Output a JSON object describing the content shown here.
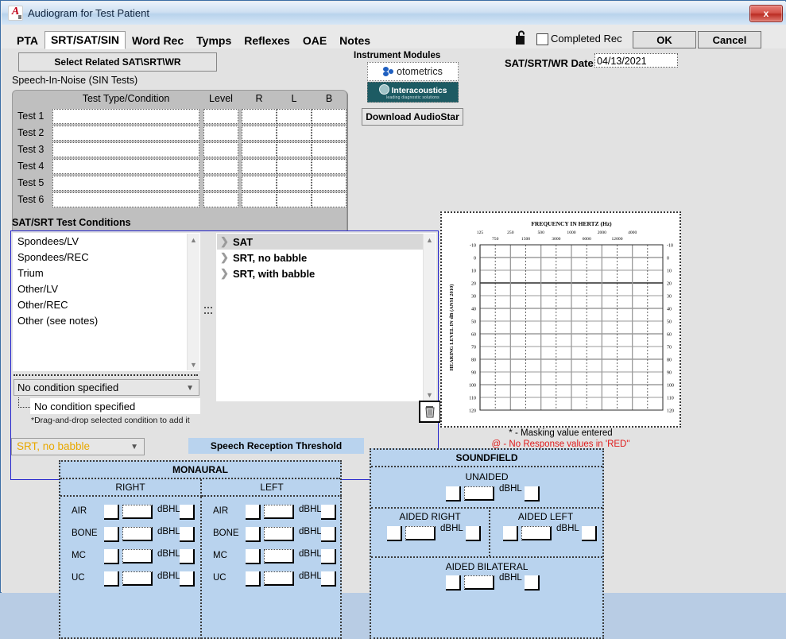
{
  "window": {
    "title": "Audiogram for Test Patient",
    "app_icon": "audiogram-app-icon",
    "close_label": "x"
  },
  "tabs": [
    {
      "label": "PTA",
      "active": false
    },
    {
      "label": "SRT/SAT/SIN",
      "active": true
    },
    {
      "label": "Word Rec",
      "active": false
    },
    {
      "label": "Tymps",
      "active": false
    },
    {
      "label": "Reflexes",
      "active": false
    },
    {
      "label": "OAE",
      "active": false
    },
    {
      "label": "Notes",
      "active": false
    }
  ],
  "header": {
    "lock_icon": "unlocked-padlock-icon",
    "completed_rec_label": "Completed Rec",
    "completed_rec_checked": false,
    "ok_label": "OK",
    "cancel_label": "Cancel"
  },
  "toolbar": {
    "select_related_label": "Select Related SAT\\SRT\\WR"
  },
  "sin": {
    "section_label": "Speech-In-Noise (SIN Tests)",
    "columns": [
      "Test Type/Condition",
      "Level",
      "R",
      "L",
      "B"
    ],
    "rows": [
      {
        "label": "Test 1",
        "type": "",
        "level": "",
        "r": "",
        "l": "",
        "b": ""
      },
      {
        "label": "Test 2",
        "type": "",
        "level": "",
        "r": "",
        "l": "",
        "b": ""
      },
      {
        "label": "Test 3",
        "type": "",
        "level": "",
        "r": "",
        "l": "",
        "b": ""
      },
      {
        "label": "Test 4",
        "type": "",
        "level": "",
        "r": "",
        "l": "",
        "b": ""
      },
      {
        "label": "Test 5",
        "type": "",
        "level": "",
        "r": "",
        "l": "",
        "b": ""
      },
      {
        "label": "Test 6",
        "type": "",
        "level": "",
        "r": "",
        "l": "",
        "b": ""
      }
    ]
  },
  "instrument_modules": {
    "label": "Instrument Modules",
    "otometrics_label": "otometrics",
    "interacoustics_label": "Interacoustics",
    "interacoustics_tagline": "leading diagnostic solutions",
    "download_label": "Download AudioStar"
  },
  "date": {
    "label": "SAT/SRT/WR Date:",
    "value": "04/13/2021"
  },
  "conditions": {
    "title": "SAT/SRT Test Conditions",
    "available": [
      "Spondees/LV",
      "Spondees/REC",
      "Trium",
      "Other/LV",
      "Other/REC",
      "Other (see notes)"
    ],
    "selected_condition": "No condition specified",
    "chosen_condition": "No condition specified",
    "drag_note": "*Drag-and-drop selected condition to add it",
    "tree": [
      {
        "label": "SAT",
        "selected": true
      },
      {
        "label": "SRT, no babble",
        "selected": false
      },
      {
        "label": "SRT, with babble",
        "selected": false
      }
    ],
    "trash_icon": "trash-can-icon"
  },
  "chart_data": {
    "type": "line",
    "title": "FREQUENCY IN HERTZ (Hz)",
    "xlabel": "FREQUENCY IN HERTZ (Hz)",
    "ylabel": "HEARING LEVEL IN dB (ANSI 2010)",
    "x_ticks_primary": [
      125,
      250,
      500,
      1000,
      2000,
      4000,
      8000
    ],
    "x_ticks_interoctave": [
      750,
      1500,
      3000,
      6000,
      12000
    ],
    "y_ticks": [
      -10,
      0,
      10,
      20,
      30,
      40,
      50,
      60,
      70,
      80,
      90,
      100,
      110,
      120
    ],
    "ylim": [
      -10,
      120
    ],
    "grid": true,
    "series": [],
    "legend": [
      {
        "symbol": "*",
        "text": "* - Masking value entered",
        "color": "#000000"
      },
      {
        "symbol": "@",
        "text": "@ - No Response values in 'RED\"",
        "color": "#e01b1b"
      }
    ]
  },
  "bottom": {
    "condition_dropdown": "SRT, no babble",
    "banner": "Speech Reception Threshold",
    "monaural": {
      "title": "MONAURAL",
      "right_label": "RIGHT",
      "left_label": "LEFT",
      "unit": "dBHL",
      "rows": [
        "AIR",
        "BONE",
        "MC",
        "UC"
      ],
      "right_values": [
        "",
        "",
        "",
        ""
      ],
      "left_values": [
        "",
        "",
        "",
        ""
      ]
    },
    "soundfield": {
      "title": "SOUNDFIELD",
      "unit": "dBHL",
      "unaided_label": "UNAIDED",
      "unaided_value": "",
      "aided_right_label": "AIDED RIGHT",
      "aided_right_value": "",
      "aided_left_label": "AIDED LEFT",
      "aided_left_value": "",
      "aided_bilateral_label": "AIDED BILATERAL",
      "aided_bilateral_value": ""
    }
  },
  "colors": {
    "panel_blue": "#b9d3ee",
    "accent_border": "#2222cc",
    "warning_text": "#e01b1b",
    "dropdown_text": "#e8a800"
  }
}
